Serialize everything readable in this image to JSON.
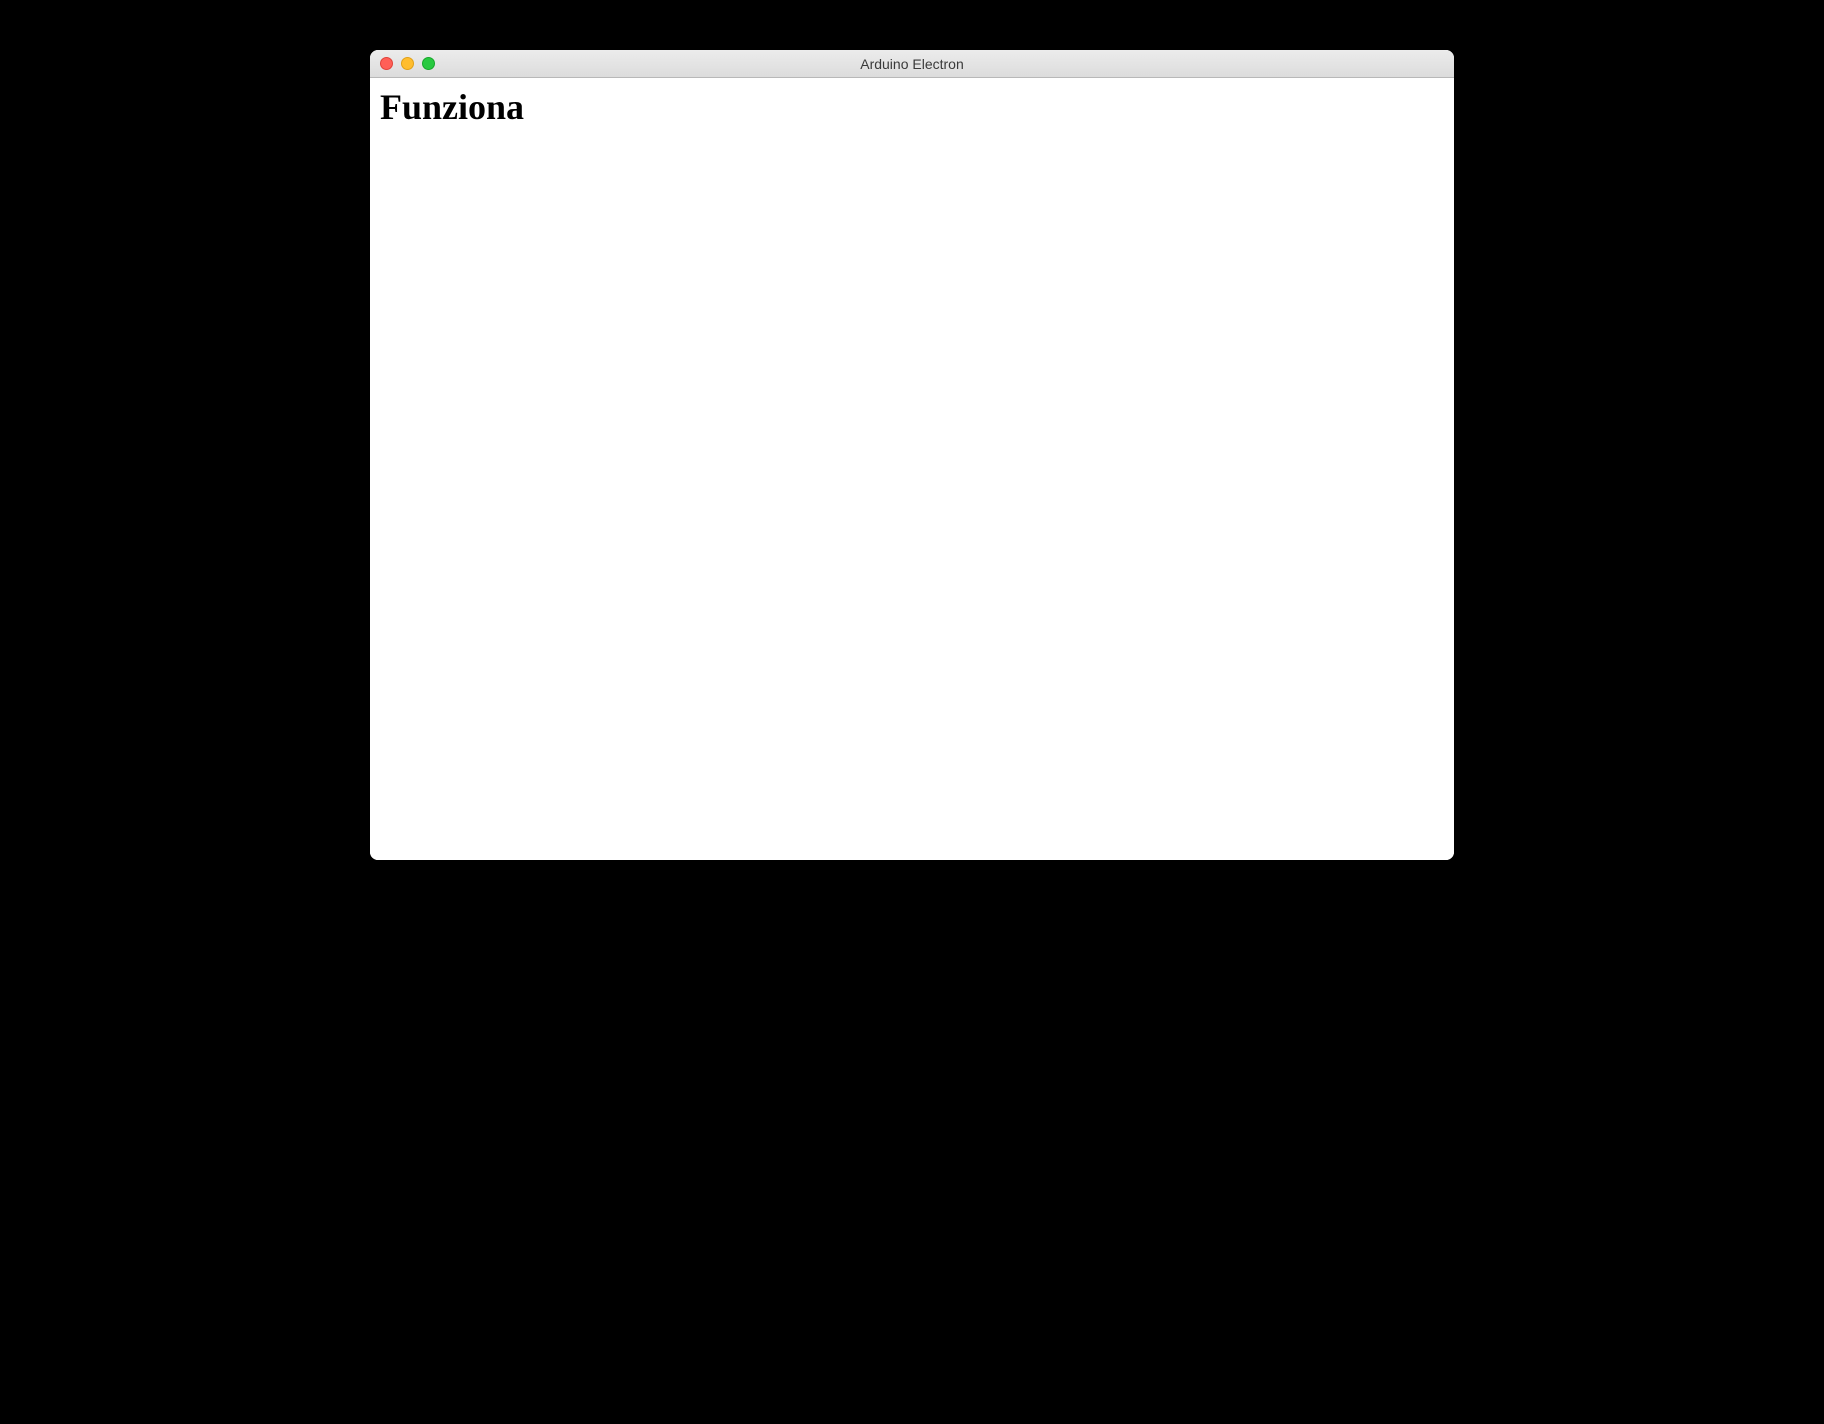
{
  "window": {
    "title": "Arduino Electron"
  },
  "content": {
    "heading": "Funziona"
  }
}
